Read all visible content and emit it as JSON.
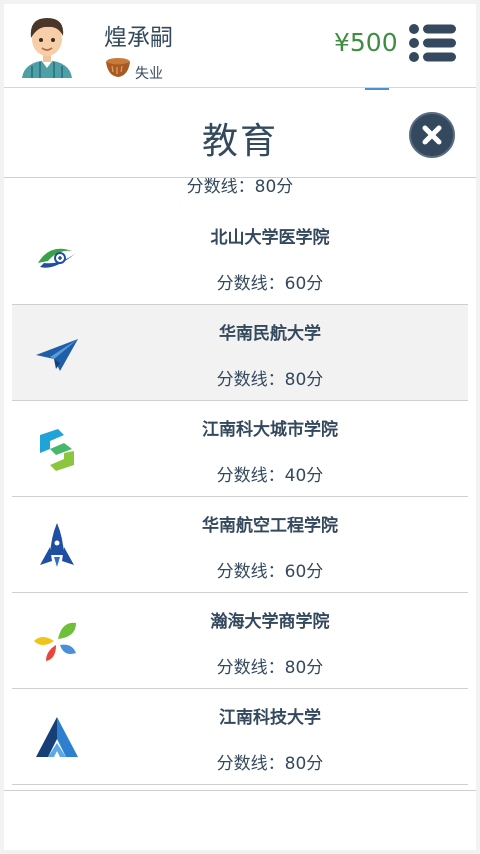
{
  "player": {
    "name": "煌承嗣",
    "status": "失业",
    "money": "¥500"
  },
  "dialog": {
    "title": "教育",
    "partial_score": "分数线：80分"
  },
  "schools": [
    {
      "name": "北山大学医学院",
      "score": "分数线：60分",
      "logo": "caduceus-logo-icon"
    },
    {
      "name": "华南民航大学",
      "score": "分数线：80分",
      "logo": "paper-plane-logo-icon"
    },
    {
      "name": "江南科大城市学院",
      "score": "分数线：40分",
      "logo": "s-cube-logo-icon"
    },
    {
      "name": "华南航空工程学院",
      "score": "分数线：60分",
      "logo": "rocket-logo-icon"
    },
    {
      "name": "瀚海大学商学院",
      "score": "分数线：80分",
      "logo": "leaves-logo-icon"
    },
    {
      "name": "江南科技大学",
      "score": "分数线：80分",
      "logo": "a-letter-logo-icon"
    }
  ],
  "colors": {
    "text": "#34495e",
    "money": "#3e8e41",
    "selected_row": "#f2f2f2",
    "close_button": "#34495e"
  }
}
